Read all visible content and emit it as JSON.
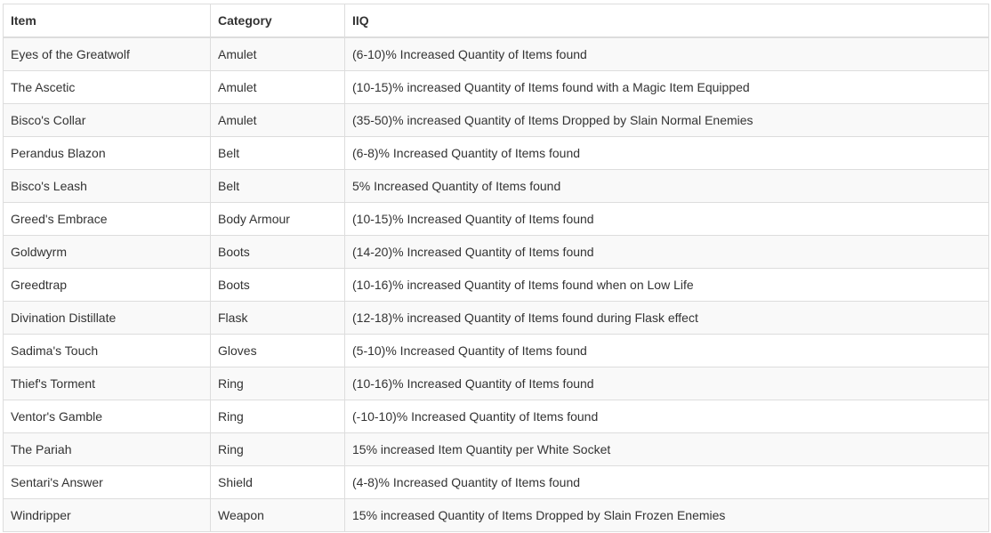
{
  "table": {
    "headers": [
      "Item",
      "Category",
      "IIQ"
    ],
    "rows": [
      [
        "Eyes of the Greatwolf",
        "Amulet",
        "(6-10)% Increased Quantity of Items found"
      ],
      [
        "The Ascetic",
        "Amulet",
        "(10-15)% increased Quantity of Items found with a Magic Item Equipped"
      ],
      [
        "Bisco's Collar",
        "Amulet",
        "(35-50)% increased Quantity of Items Dropped by Slain Normal Enemies"
      ],
      [
        "Perandus Blazon",
        "Belt",
        "(6-8)% Increased Quantity of Items found"
      ],
      [
        "Bisco's Leash",
        "Belt",
        "5% Increased Quantity of Items found"
      ],
      [
        "Greed's Embrace",
        "Body Armour",
        "(10-15)% Increased Quantity of Items found"
      ],
      [
        "Goldwyrm",
        "Boots",
        "(14-20)% Increased Quantity of Items found"
      ],
      [
        "Greedtrap",
        "Boots",
        "(10-16)% increased Quantity of Items found when on Low Life"
      ],
      [
        "Divination Distillate",
        "Flask",
        "(12-18)% increased Quantity of Items found during Flask effect"
      ],
      [
        "Sadima's Touch",
        "Gloves",
        "(5-10)% Increased Quantity of Items found"
      ],
      [
        "Thief's Torment",
        "Ring",
        "(10-16)% Increased Quantity of Items found"
      ],
      [
        "Ventor's Gamble",
        "Ring",
        "(-10-10)% Increased Quantity of Items found"
      ],
      [
        "The Pariah",
        "Ring",
        "15% increased Item Quantity per White Socket"
      ],
      [
        "Sentari's Answer",
        "Shield",
        "(4-8)% Increased Quantity of Items found"
      ],
      [
        "Windripper",
        "Weapon",
        "15% increased Quantity of Items Dropped by Slain Frozen Enemies"
      ]
    ]
  }
}
